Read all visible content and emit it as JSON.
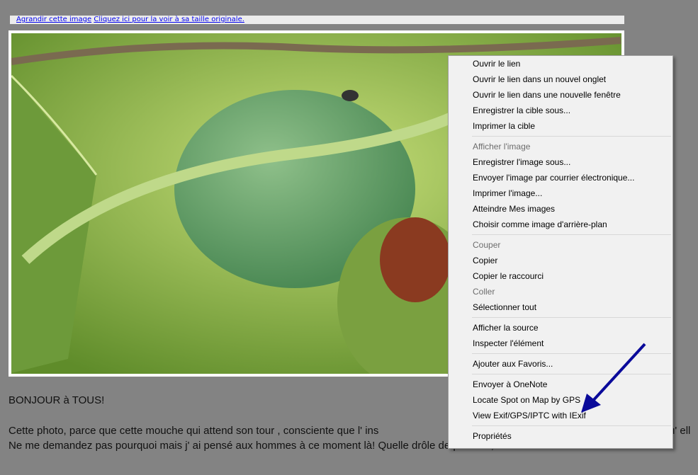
{
  "links": {
    "enlarge": "Agrandir cette image",
    "original": "Cliquez ici pour la voir à sa taille originale."
  },
  "text": {
    "greeting": "BONJOUR à TOUS!",
    "line1_visible": "Cette photo, parce que cette mouche qui attend son tour , consciente que l' ins",
    "line1_tail": "u' ell",
    "line2": "Ne me demandez pas pourquoi mais j' ai pensé aux hommes à ce moment là! Quelle drôle de pensée , me direz vous!"
  },
  "menu": {
    "groups": [
      [
        {
          "label": "Ouvrir le lien"
        },
        {
          "label": "Ouvrir le lien dans un nouvel onglet"
        },
        {
          "label": "Ouvrir le lien dans une nouvelle fenêtre"
        },
        {
          "label": "Enregistrer la cible sous..."
        },
        {
          "label": "Imprimer la cible"
        }
      ],
      [
        {
          "label": "Afficher l'image",
          "disabled": true
        },
        {
          "label": "Enregistrer l'image sous..."
        },
        {
          "label": "Envoyer l'image par courrier électronique..."
        },
        {
          "label": "Imprimer l'image..."
        },
        {
          "label": "Atteindre Mes images"
        },
        {
          "label": "Choisir comme image d'arrière-plan"
        }
      ],
      [
        {
          "label": "Couper",
          "disabled": true
        },
        {
          "label": "Copier"
        },
        {
          "label": "Copier le raccourci"
        },
        {
          "label": "Coller",
          "disabled": true
        },
        {
          "label": "Sélectionner tout"
        }
      ],
      [
        {
          "label": "Afficher la source"
        },
        {
          "label": "Inspecter l'élément"
        }
      ],
      [
        {
          "label": "Ajouter aux Favoris..."
        }
      ],
      [
        {
          "label": "Envoyer à OneNote"
        },
        {
          "label": "Locate Spot on Map by GPS"
        },
        {
          "label": "View Exif/GPS/IPTC with IExif"
        }
      ],
      [
        {
          "label": "Propriétés"
        }
      ]
    ]
  },
  "colors": {
    "arrow": "#0a0a9a"
  }
}
